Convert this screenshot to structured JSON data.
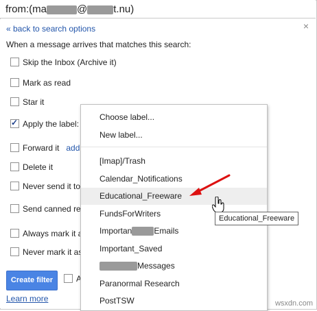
{
  "search_bar": {
    "prefix": "from:(ma",
    "middle": "@",
    "suffix": "t.nu)"
  },
  "filter_panel": {
    "back_link": "« back to search options",
    "close": "×",
    "heading": "When a message arrives that matches this search:",
    "options": {
      "skip_inbox": "Skip the Inbox (Archive it)",
      "mark_read": "Mark as read",
      "star": "Star it",
      "apply_label": "Apply the label:",
      "forward": "Forward it",
      "forward_add": "add",
      "delete": "Delete it",
      "never_spam": "Never send it to",
      "canned": "Send canned re",
      "always_important": "Always mark it a",
      "never_important": "Never mark it as"
    },
    "create_button": "Create filter",
    "also_apply_prefix": "A",
    "learn_more": "Learn more"
  },
  "label_dropdown": {
    "choose": "Choose label...",
    "new": "New label...",
    "items": [
      "[Imap]/Trash",
      "Calendar_Notifications",
      "Educational_Freeware",
      "FundsForWriters",
      "Emails",
      "Important_Saved",
      "Messages",
      "Paranormal Research",
      "PostTSW"
    ],
    "important_prefix": "Importan",
    "hovered": "Educational_Freeware"
  },
  "tooltip": "Educational_Freeware",
  "watermark": "wsxdn.com",
  "colors": {
    "accent": "#4a84e4",
    "link": "#2255aa",
    "arrow": "#dd1111"
  }
}
